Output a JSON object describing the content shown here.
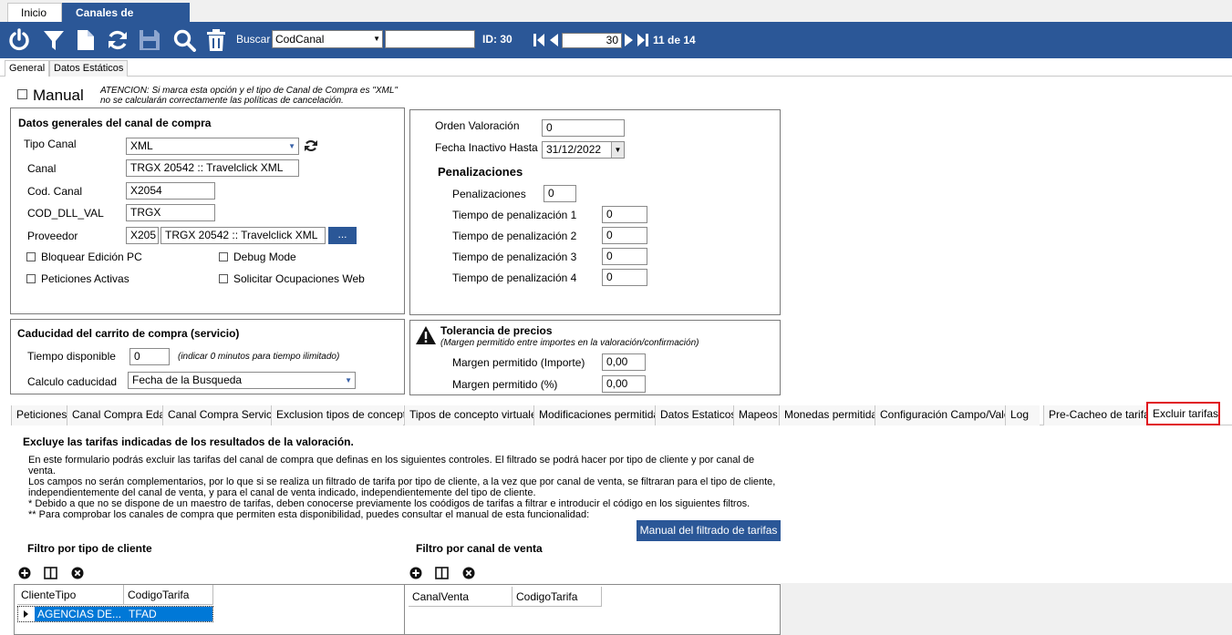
{
  "top_tabs": [
    "Inicio",
    "Canales de Compra"
  ],
  "toolbar": {
    "search_label": "Buscar",
    "search_field": "CodCanal",
    "search_value": "",
    "id_label": "ID: 30",
    "nav_value": "30",
    "record_position": "11 de 14"
  },
  "sub_tabs": [
    "General",
    "Datos Estáticos"
  ],
  "manual": {
    "label": "Manual",
    "note_line1": "ATENCION: Si marca esta opción y el tipo de Canal de Compra es \"XML\"",
    "note_line2": "no se calcularán correctamente las políticas de cancelación."
  },
  "datos_generales": {
    "title": "Datos generales del canal de compra",
    "tipo_canal_label": "Tipo Canal",
    "tipo_canal_value": "XML",
    "canal_label": "Canal",
    "canal_value": "TRGX 20542 :: Travelclick XML",
    "cod_canal_label": "Cod. Canal",
    "cod_canal_value": "X2054",
    "cod_dll_label": "COD_DLL_VAL",
    "cod_dll_value": "TRGX",
    "proveedor_label": "Proveedor",
    "proveedor_code": "X205",
    "proveedor_name": "TRGX 20542 :: Travelclick XML",
    "proveedor_button": "...",
    "chk_bloquear": "Bloquear Edición PC",
    "chk_debug": "Debug Mode",
    "chk_peticiones": "Peticiones Activas",
    "chk_solicitar": "Solicitar Ocupaciones Web"
  },
  "valoracion": {
    "orden_label": "Orden Valoración",
    "orden_value": "0",
    "fecha_label": "Fecha Inactivo Hasta",
    "fecha_value": "31/12/2022",
    "pen_title": "Penalizaciones",
    "pen_label": "Penalizaciones",
    "pen_value": "0",
    "t1_label": "Tiempo de penalización 1",
    "t1_value": "0",
    "t2_label": "Tiempo de penalización 2",
    "t2_value": "0",
    "t3_label": "Tiempo de penalización 3",
    "t3_value": "0",
    "t4_label": "Tiempo de penalización 4",
    "t4_value": "0"
  },
  "caducidad": {
    "title": "Caducidad del carrito de compra (servicio)",
    "tiempo_label": "Tiempo disponible",
    "tiempo_value": "0",
    "tiempo_note": "(indicar 0 minutos para tiempo ilimitado)",
    "calculo_label": "Calculo caducidad",
    "calculo_value": "Fecha de la Busqueda"
  },
  "tolerancia": {
    "title": "Tolerancia de precios",
    "subtitle": "(Margen permitido entre importes en la valoración/confirmación)",
    "importe_label": "Margen permitido (Importe)",
    "importe_value": "0,00",
    "pct_label": "Margen permitido (%)",
    "pct_value": "0,00"
  },
  "bottom_tabs": [
    "Peticiones",
    "Canal Compra Edad",
    "Canal Compra Servicio",
    "Exclusion tipos de concepto",
    "Tipos de concepto virtuales",
    "Modificaciones permitidas",
    "Datos Estaticos",
    "Mapeos",
    "Monedas permitidas",
    "Configuración Campo/Valor",
    "Log",
    "Pre-Cacheo de tarifas",
    "Excluir tarifas"
  ],
  "excluir": {
    "title": "Excluye las tarifas indicadas de los resultados de la valoración.",
    "p1a": "En este formulario podrás excluir las tarifas del canal de compra que definas en los siguientes controles. El filtrado se podrá hacer por tipo de cliente y por canal de",
    "p1b": "venta.",
    "p2a": "Los campos no serán complementarios, por lo que si se realiza un filtrado de tarifa por tipo de cliente, a la vez que por canal de venta, se filtraran para el tipo de cliente,",
    "p2b": "independientemente del canal de venta, y para el canal de venta indicado, independientemente del tipo de cliente.",
    "p3": "* Debido a que no se dispone de un maestro de tarifas, deben conocerse previamente los coódigos de tarifas a filtrar e introducir el código en los siguientes filtros.",
    "p4": "** Para comprobar los canales de compra que permiten esta disponibilidad, puedes consultar el manual de esta funcionalidad:",
    "manual_button": "Manual del filtrado de tarifas",
    "filtro_cliente": "Filtro por tipo de cliente",
    "filtro_canal": "Filtro por canal de venta",
    "grid1_cols": [
      "ClienteTipo",
      "CodigoTarifa"
    ],
    "grid1_row": [
      "AGENCIAS DE...",
      "TFAD"
    ],
    "grid2_cols": [
      "CanalVenta",
      "CodigoTarifa"
    ]
  },
  "colors": {
    "brand": "#2b5797",
    "highlight": "#e0141e",
    "selection": "#0078d7"
  },
  "icons": [
    "power-icon",
    "filter-icon",
    "new-document-icon",
    "refresh-icon",
    "save-icon",
    "search-icon",
    "trash-icon",
    "first-record-icon",
    "previous-record-icon",
    "next-record-icon",
    "last-record-icon",
    "warning-icon",
    "add-icon",
    "columns-icon",
    "remove-icon"
  ]
}
